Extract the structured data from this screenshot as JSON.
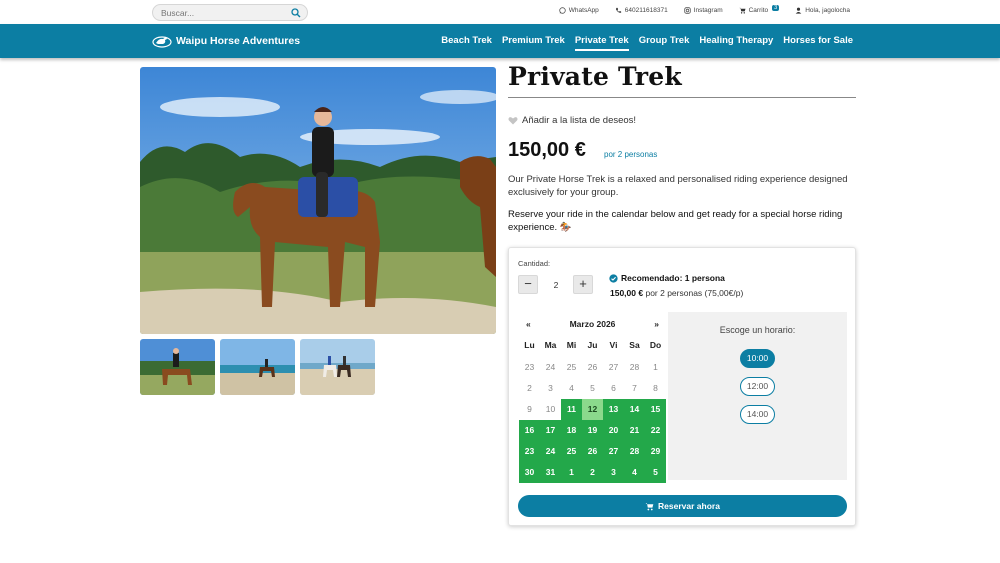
{
  "search": {
    "placeholder": "Buscar..."
  },
  "toplinks": {
    "whatsapp": "WhatsApp",
    "phone": "640211618371",
    "instagram": "Instagram",
    "cart": "Carrito",
    "cart_count": "3",
    "user": "Hola, jagolocha"
  },
  "brand": {
    "name": "Waipu Horse Adventures"
  },
  "nav": [
    "Beach Trek",
    "Premium Trek",
    "Private Trek",
    "Group Trek",
    "Healing Therapy",
    "Horses for Sale"
  ],
  "nav_active": "Private Trek",
  "product": {
    "title": "Private Trek",
    "wishlist": "Añadir a la lista de deseos!",
    "price": "150,00 €",
    "per": "por 2 personas",
    "description": "Our Private Horse Trek is a relaxed and personalised riding experience designed exclusively for your group.",
    "reserve_text": "Reserve your ride in the calendar below and get ready for a special horse riding experience. 🏇"
  },
  "booking": {
    "qty_label": "Cantidad:",
    "qty_minus": "−",
    "qty_value": "2",
    "qty_plus": "+",
    "recommended": "Recomendado: 1 persona",
    "rec_price": "150,00 €",
    "rec_detail": "por 2 personas (75,00€/p)",
    "calendar": {
      "prev": "«",
      "month": "Marzo 2026",
      "next": "»",
      "weekdays": [
        "Lu",
        "Ma",
        "Mi",
        "Ju",
        "Vi",
        "Sa",
        "Do"
      ],
      "weeks": [
        [
          "23",
          "24",
          "25",
          "26",
          "27",
          "28",
          "1"
        ],
        [
          "2",
          "3",
          "4",
          "5",
          "6",
          "7",
          "8"
        ],
        [
          "9",
          "10",
          "11",
          "12",
          "13",
          "14",
          "15"
        ],
        [
          "16",
          "17",
          "18",
          "19",
          "20",
          "21",
          "22"
        ],
        [
          "23",
          "24",
          "25",
          "26",
          "27",
          "28",
          "29"
        ],
        [
          "30",
          "31",
          "1",
          "2",
          "3",
          "4",
          "5"
        ]
      ],
      "available_from_index": 16,
      "selected_index": 17,
      "available_color": "#23a84a",
      "selected_color": "#8bd98c"
    },
    "times_title": "Escoge un horario:",
    "slots": [
      "10:00",
      "12:00",
      "14:00"
    ],
    "selected_slot": "10:00",
    "book_button": "Reservar ahora"
  },
  "colors": {
    "brand": "#0c7ea3"
  }
}
